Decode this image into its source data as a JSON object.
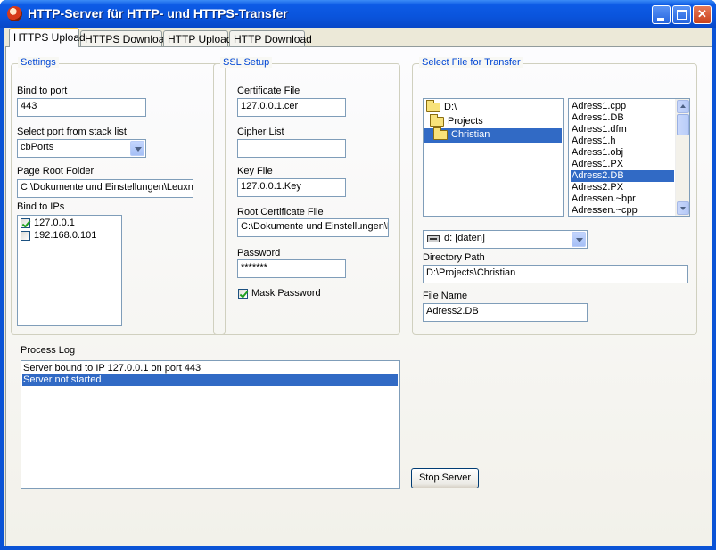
{
  "window": {
    "title": "HTTP-Server für HTTP- und HTTPS-Transfer"
  },
  "tabs": [
    {
      "label": "HTTPS Upload",
      "active": true
    },
    {
      "label": "HTTPS Download",
      "active": false
    },
    {
      "label": "HTTP Upload",
      "active": false
    },
    {
      "label": "HTTP Download",
      "active": false
    }
  ],
  "settings": {
    "title": "Settings",
    "bind_port_label": "Bind to port",
    "bind_port_value": "443",
    "stack_label": "Select port from stack list",
    "stack_value": "cbPorts",
    "root_label": "Page Root Folder",
    "root_value": "C:\\Dokumente und Einstellungen\\Leuxne",
    "ips_label": "Bind to IPs",
    "ips": [
      {
        "label": "127.0.0.1",
        "checked": true
      },
      {
        "label": "192.168.0.101",
        "checked": false
      }
    ]
  },
  "ssl": {
    "title": "SSL Setup",
    "cert_label": "Certificate File",
    "cert_value": "127.0.0.1.cer",
    "cipher_label": "Cipher List",
    "cipher_value": "",
    "key_label": "Key File",
    "key_value": "127.0.0.1.Key",
    "root_cert_label": "Root Certificate File",
    "root_cert_value": "C:\\Dokumente und Einstellungen\\L",
    "password_label": "Password",
    "password_value": "*******",
    "mask_label": "Mask Password",
    "mask_checked": true
  },
  "select_file": {
    "title": "Select File for Transfer",
    "tree": [
      {
        "label": "D:\\",
        "selected": false
      },
      {
        "label": "Projects",
        "selected": false
      },
      {
        "label": "Christian",
        "selected": true
      }
    ],
    "files": [
      {
        "name": "Adress1.cpp",
        "selected": false
      },
      {
        "name": "Adress1.DB",
        "selected": false
      },
      {
        "name": "Adress1.dfm",
        "selected": false
      },
      {
        "name": "Adress1.h",
        "selected": false
      },
      {
        "name": "Adress1.obj",
        "selected": false
      },
      {
        "name": "Adress1.PX",
        "selected": false
      },
      {
        "name": "Adress2.DB",
        "selected": true
      },
      {
        "name": "Adress2.PX",
        "selected": false
      },
      {
        "name": "Adressen.~bpr",
        "selected": false
      },
      {
        "name": "Adressen.~cpp",
        "selected": false
      }
    ],
    "drive_value": "d: [daten]",
    "dir_path_label": "Directory Path",
    "dir_path_value": "D:\\Projects\\Christian",
    "file_name_label": "File Name",
    "file_name_value": "Adress2.DB"
  },
  "process_log": {
    "label": "Process Log",
    "entries": [
      {
        "text": "Server bound to IP 127.0.0.1 on port 443",
        "selected": false
      },
      {
        "text": "Server not started",
        "selected": true
      }
    ]
  },
  "stop_button": {
    "label": "Stop Server"
  },
  "colors": {
    "title_bar": "#0a54dc",
    "selection": "#316ac5",
    "group_title": "#0046d5",
    "panel": "#ece9d8"
  },
  "icons": [
    "app-icon",
    "minimize-icon",
    "maximize-icon",
    "close-icon",
    "folder-icon",
    "open-folder-icon",
    "drive-icon",
    "chevron-down-icon",
    "checkmark-icon"
  ]
}
